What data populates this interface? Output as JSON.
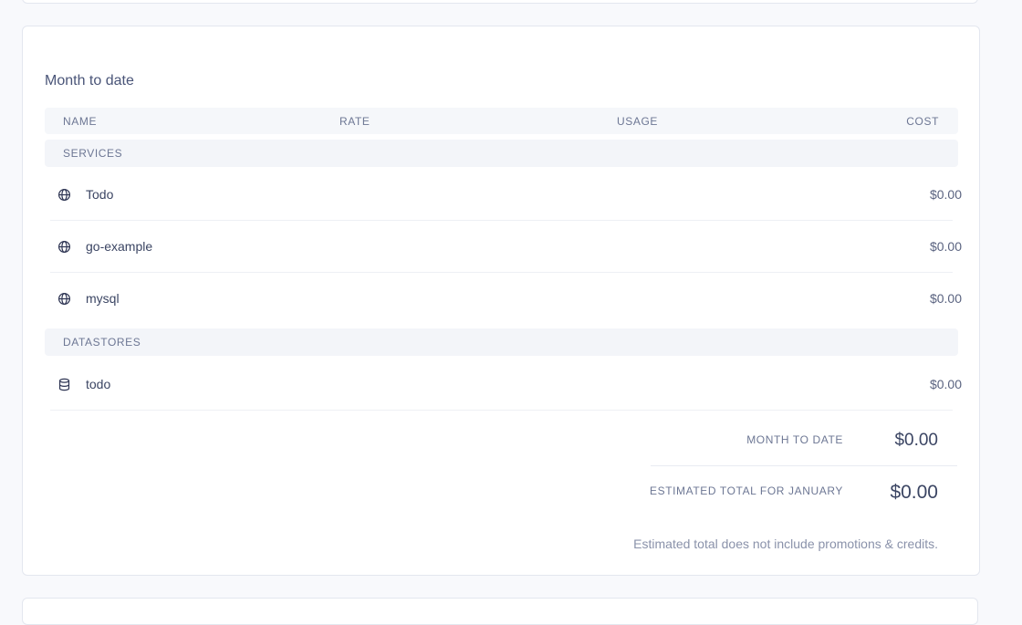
{
  "card": {
    "title": "Month to date",
    "columns": {
      "name": "NAME",
      "rate": "RATE",
      "usage": "USAGE",
      "cost": "COST"
    },
    "sections": [
      {
        "label": "SERVICES",
        "items": [
          {
            "name": "Todo",
            "cost": "$0.00",
            "icon": "globe-icon"
          },
          {
            "name": "go-example",
            "cost": "$0.00",
            "icon": "globe-icon"
          },
          {
            "name": "mysql",
            "cost": "$0.00",
            "icon": "globe-icon"
          }
        ]
      },
      {
        "label": "DATASTORES",
        "items": [
          {
            "name": "todo",
            "cost": "$0.00",
            "icon": "database-icon"
          }
        ]
      }
    ],
    "summary": {
      "month_to_date_label": "MONTH TO DATE",
      "month_to_date_value": "$0.00",
      "estimated_label": "ESTIMATED TOTAL FOR JANUARY",
      "estimated_value": "$0.00"
    },
    "footnote": "Estimated total does not include promotions & credits."
  },
  "colors": {
    "background": "#f8f9fc",
    "card": "#ffffff",
    "text": "#3b4563",
    "muted": "#6d7794",
    "section_bg": "#f3f5f9"
  }
}
